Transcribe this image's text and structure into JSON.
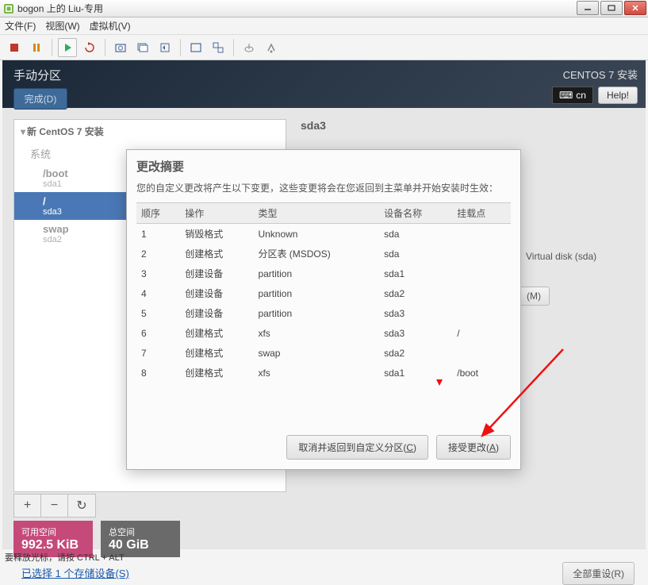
{
  "window": {
    "title": "bogon 上的 Liu-专用"
  },
  "menus": {
    "file": "文件(F)",
    "view": "视图(W)",
    "vm": "虚拟机(V)"
  },
  "installer": {
    "header": {
      "title": "手动分区",
      "done": "完成(D)",
      "product": "CENTOS 7 安装",
      "lang": "cn",
      "help": "Help!"
    },
    "sidebar": {
      "heading": "新 CentOS 7 安装",
      "group_system": "系统",
      "items": [
        {
          "mount": "/boot",
          "dev": "sda1"
        },
        {
          "mount": "/",
          "dev": "sda3"
        },
        {
          "mount": "swap",
          "dev": "sda2"
        }
      ]
    },
    "detail": {
      "title": "sda3",
      "vdisk": "Virtual disk (sda)",
      "modify": "(M)"
    },
    "space": {
      "avail_lbl": "可用空间",
      "avail_val": "992.5 KiB",
      "total_lbl": "总空间",
      "total_val": "40 GiB"
    },
    "storage_link": "已选择 1 个存储设备(S)",
    "reset": "全部重设(R)"
  },
  "modal": {
    "title": "更改摘要",
    "desc": "您的自定义更改将产生以下变更，这些变更将会在您返回到主菜单并开始安装时生效：",
    "cols": {
      "order": "顺序",
      "op": "操作",
      "type": "类型",
      "devname": "设备名称",
      "mount": "挂载点"
    },
    "rows": [
      {
        "n": "1",
        "op": "销毁格式",
        "opc": "destroy",
        "type": "Unknown",
        "dev": "sda",
        "mount": ""
      },
      {
        "n": "2",
        "op": "创建格式",
        "opc": "create",
        "type": "分区表 (MSDOS)",
        "dev": "sda",
        "mount": ""
      },
      {
        "n": "3",
        "op": "创建设备",
        "opc": "create",
        "type": "partition",
        "dev": "sda1",
        "mount": ""
      },
      {
        "n": "4",
        "op": "创建设备",
        "opc": "create",
        "type": "partition",
        "dev": "sda2",
        "mount": ""
      },
      {
        "n": "5",
        "op": "创建设备",
        "opc": "create",
        "type": "partition",
        "dev": "sda3",
        "mount": ""
      },
      {
        "n": "6",
        "op": "创建格式",
        "opc": "create",
        "type": "xfs",
        "dev": "sda3",
        "mount": "/"
      },
      {
        "n": "7",
        "op": "创建格式",
        "opc": "create",
        "type": "swap",
        "dev": "sda2",
        "mount": ""
      },
      {
        "n": "8",
        "op": "创建格式",
        "opc": "create",
        "type": "xfs",
        "dev": "sda1",
        "mount": "/boot"
      }
    ],
    "cancel_pre": "取消并返回到自定义分区(",
    "cancel_u": "C",
    "cancel_post": ")",
    "accept_pre": "接受更改(",
    "accept_u": "A",
    "accept_post": ")"
  },
  "icons": {
    "kb": "⌨"
  },
  "status": "要释放光标，请按 CTRL + ALT"
}
